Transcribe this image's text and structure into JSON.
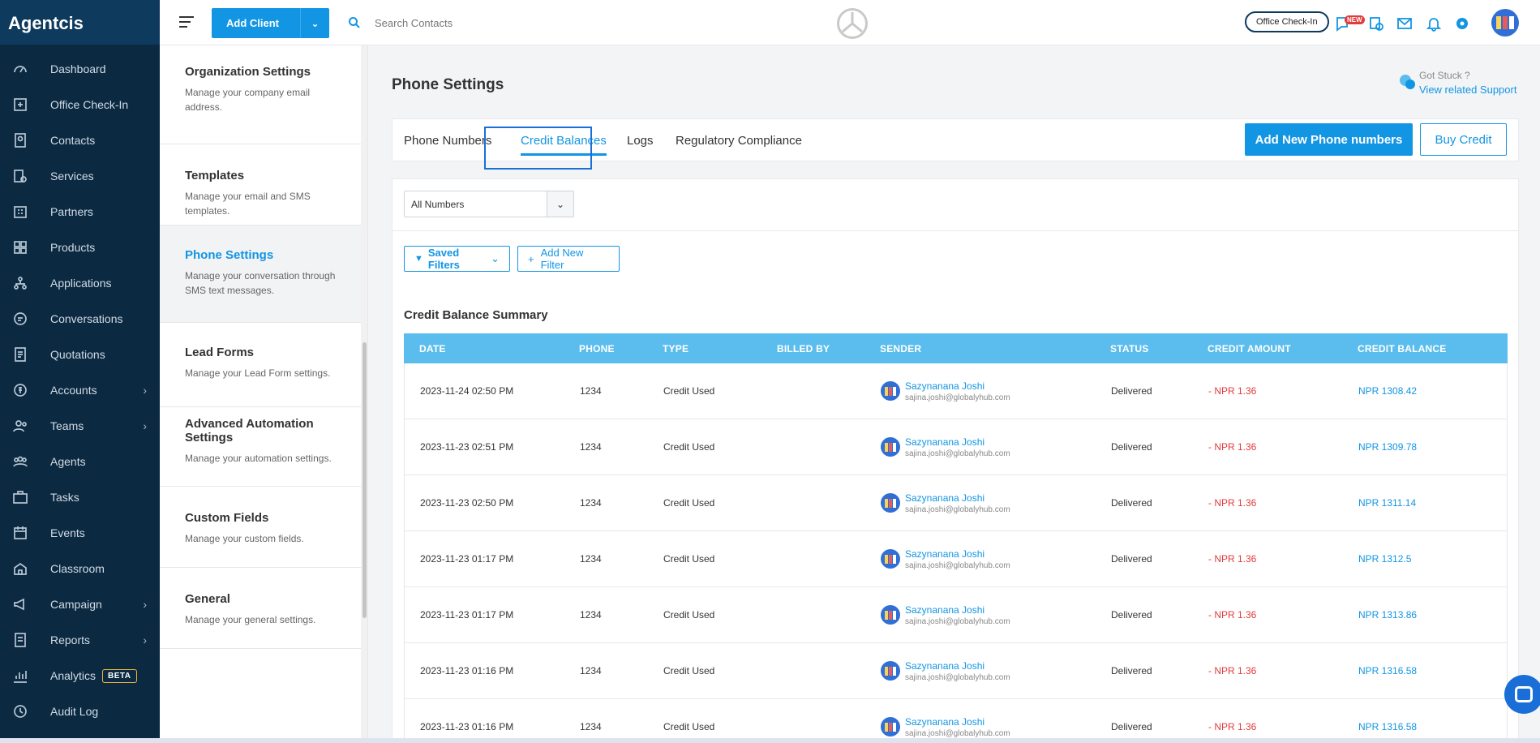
{
  "app": {
    "brand": "Agentcis"
  },
  "sidebar": {
    "items": [
      {
        "label": "Dashboard",
        "icon": "dashboard-icon",
        "has_chevron": false
      },
      {
        "label": "Office Check-In",
        "icon": "office-checkin-icon",
        "has_chevron": false
      },
      {
        "label": "Contacts",
        "icon": "contacts-icon",
        "has_chevron": false
      },
      {
        "label": "Services",
        "icon": "services-icon",
        "has_chevron": false
      },
      {
        "label": "Partners",
        "icon": "partners-icon",
        "has_chevron": false
      },
      {
        "label": "Products",
        "icon": "products-icon",
        "has_chevron": false
      },
      {
        "label": "Applications",
        "icon": "applications-icon",
        "has_chevron": false
      },
      {
        "label": "Conversations",
        "icon": "conversations-icon",
        "has_chevron": false
      },
      {
        "label": "Quotations",
        "icon": "quotations-icon",
        "has_chevron": false
      },
      {
        "label": "Accounts",
        "icon": "accounts-icon",
        "has_chevron": true
      },
      {
        "label": "Teams",
        "icon": "teams-icon",
        "has_chevron": true
      },
      {
        "label": "Agents",
        "icon": "agents-icon",
        "has_chevron": false
      },
      {
        "label": "Tasks",
        "icon": "tasks-icon",
        "has_chevron": false
      },
      {
        "label": "Events",
        "icon": "events-icon",
        "has_chevron": false
      },
      {
        "label": "Classroom",
        "icon": "classroom-icon",
        "has_chevron": false
      },
      {
        "label": "Campaign",
        "icon": "campaign-icon",
        "has_chevron": true
      },
      {
        "label": "Reports",
        "icon": "reports-icon",
        "has_chevron": true
      },
      {
        "label": "Analytics",
        "icon": "analytics-icon",
        "has_chevron": false,
        "badge": "BETA"
      },
      {
        "label": "Audit Log",
        "icon": "audit-log-icon",
        "has_chevron": false
      }
    ]
  },
  "header": {
    "add_client_label": "Add Client",
    "search_placeholder": "Search Contacts",
    "office_checkin_label": "Office Check-In",
    "new_badge": "NEW"
  },
  "settings_menu": [
    {
      "title": "Organization Settings",
      "desc": "Manage your company email address.",
      "active": false
    },
    {
      "title": "Templates",
      "desc": "Manage your email and SMS templates.",
      "active": false
    },
    {
      "title": "Phone Settings",
      "desc": "Manage your conversation through SMS text messages.",
      "active": true
    },
    {
      "title": "Lead Forms",
      "desc": "Manage your Lead Form settings.",
      "active": false
    },
    {
      "title": "Advanced Automation Settings",
      "desc": "Manage your automation settings.",
      "active": false
    },
    {
      "title": "Custom Fields",
      "desc": "Manage your custom fields.",
      "active": false
    },
    {
      "title": "General",
      "desc": "Manage your general settings.",
      "active": false
    }
  ],
  "main": {
    "title": "Phone Settings",
    "help": {
      "line1": "Got Stuck ?",
      "line2": "View related Support"
    },
    "tabs": [
      {
        "label": "Phone Numbers",
        "active": false
      },
      {
        "label": "Credit Balances",
        "active": true
      },
      {
        "label": "Logs",
        "active": false
      },
      {
        "label": "Regulatory Compliance",
        "active": false
      }
    ],
    "add_phone_label": "Add New Phone numbers",
    "buy_credit_label": "Buy Credit",
    "number_select": "All Numbers",
    "saved_filters_label": "Saved Filters",
    "add_filter_label": "Add New Filter",
    "summary_title": "Credit Balance Summary",
    "table": {
      "columns": [
        "DATE",
        "PHONE",
        "TYPE",
        "BILLED BY",
        "SENDER",
        "STATUS",
        "CREDIT AMOUNT",
        "CREDIT BALANCE"
      ],
      "rows": [
        {
          "date": "2023-11-24 02:50 PM",
          "phone": "1234",
          "type": "Credit Used",
          "billed_by": "",
          "sender_name": "Sazynanana Joshi",
          "sender_email": "sajina.joshi@globalyhub.com",
          "status": "Delivered",
          "amount": "- NPR 1.36",
          "balance": "NPR 1308.42"
        },
        {
          "date": "2023-11-23 02:51 PM",
          "phone": "1234",
          "type": "Credit Used",
          "billed_by": "",
          "sender_name": "Sazynanana Joshi",
          "sender_email": "sajina.joshi@globalyhub.com",
          "status": "Delivered",
          "amount": "- NPR 1.36",
          "balance": "NPR 1309.78"
        },
        {
          "date": "2023-11-23 02:50 PM",
          "phone": "1234",
          "type": "Credit Used",
          "billed_by": "",
          "sender_name": "Sazynanana Joshi",
          "sender_email": "sajina.joshi@globalyhub.com",
          "status": "Delivered",
          "amount": "- NPR 1.36",
          "balance": "NPR 1311.14"
        },
        {
          "date": "2023-11-23 01:17 PM",
          "phone": "1234",
          "type": "Credit Used",
          "billed_by": "",
          "sender_name": "Sazynanana Joshi",
          "sender_email": "sajina.joshi@globalyhub.com",
          "status": "Delivered",
          "amount": "- NPR 1.36",
          "balance": "NPR 1312.5"
        },
        {
          "date": "2023-11-23 01:17 PM",
          "phone": "1234",
          "type": "Credit Used",
          "billed_by": "",
          "sender_name": "Sazynanana Joshi",
          "sender_email": "sajina.joshi@globalyhub.com",
          "status": "Delivered",
          "amount": "- NPR 1.36",
          "balance": "NPR 1313.86"
        },
        {
          "date": "2023-11-23 01:16 PM",
          "phone": "1234",
          "type": "Credit Used",
          "billed_by": "",
          "sender_name": "Sazynanana Joshi",
          "sender_email": "sajina.joshi@globalyhub.com",
          "status": "Delivered",
          "amount": "- NPR 1.36",
          "balance": "NPR 1316.58"
        },
        {
          "date": "2023-11-23 01:16 PM",
          "phone": "1234",
          "type": "Credit Used",
          "billed_by": "",
          "sender_name": "Sazynanana Joshi",
          "sender_email": "sajina.joshi@globalyhub.com",
          "status": "Delivered",
          "amount": "- NPR 1.36",
          "balance": "NPR 1316.58"
        }
      ]
    }
  },
  "colors": {
    "accent": "#1295e3",
    "sidebar": "#0b2a42",
    "table_header": "#5bbdee",
    "negative": "#e23b3b"
  }
}
